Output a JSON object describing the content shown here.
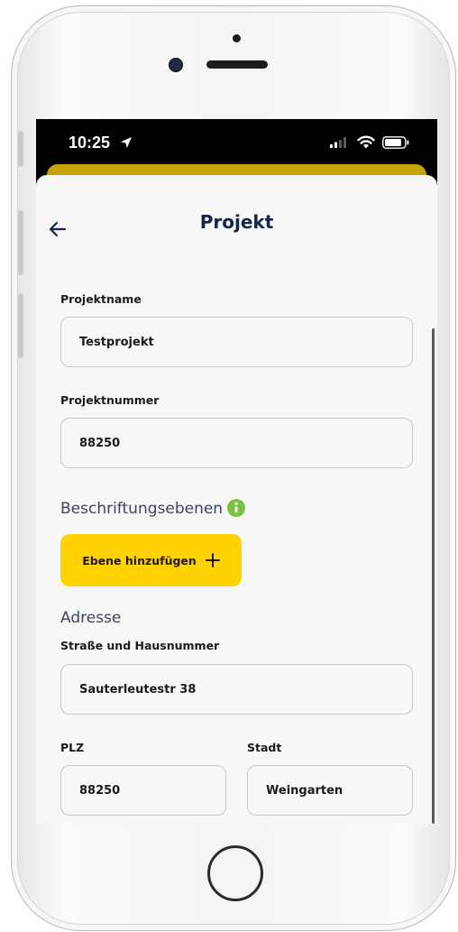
{
  "status_bar": {
    "time": "10:25",
    "icons": [
      "location-arrow-icon",
      "signal-icon",
      "wifi-icon",
      "battery-icon"
    ]
  },
  "header": {
    "title": "Projekt",
    "back_icon": "back-arrow-icon"
  },
  "form": {
    "project_name": {
      "label": "Projektname",
      "value": "Testprojekt"
    },
    "project_number": {
      "label": "Projektnummer",
      "value": "88250"
    },
    "layers": {
      "heading": "Beschriftungsebenen",
      "info_icon": "info-icon",
      "add_button_label": "Ebene hinzufügen",
      "add_icon": "plus-icon"
    },
    "address": {
      "heading": "Adresse",
      "street": {
        "label": "Straße und Hausnummer",
        "value": "Sauterleutestr 38"
      },
      "zip": {
        "label": "PLZ",
        "value": "88250"
      },
      "city": {
        "label": "Stadt",
        "value": "Weingarten"
      }
    }
  },
  "colors": {
    "accent": "#ffd200",
    "title": "#162447",
    "info_green": "#7cc242",
    "background": "#f7f7f8"
  }
}
